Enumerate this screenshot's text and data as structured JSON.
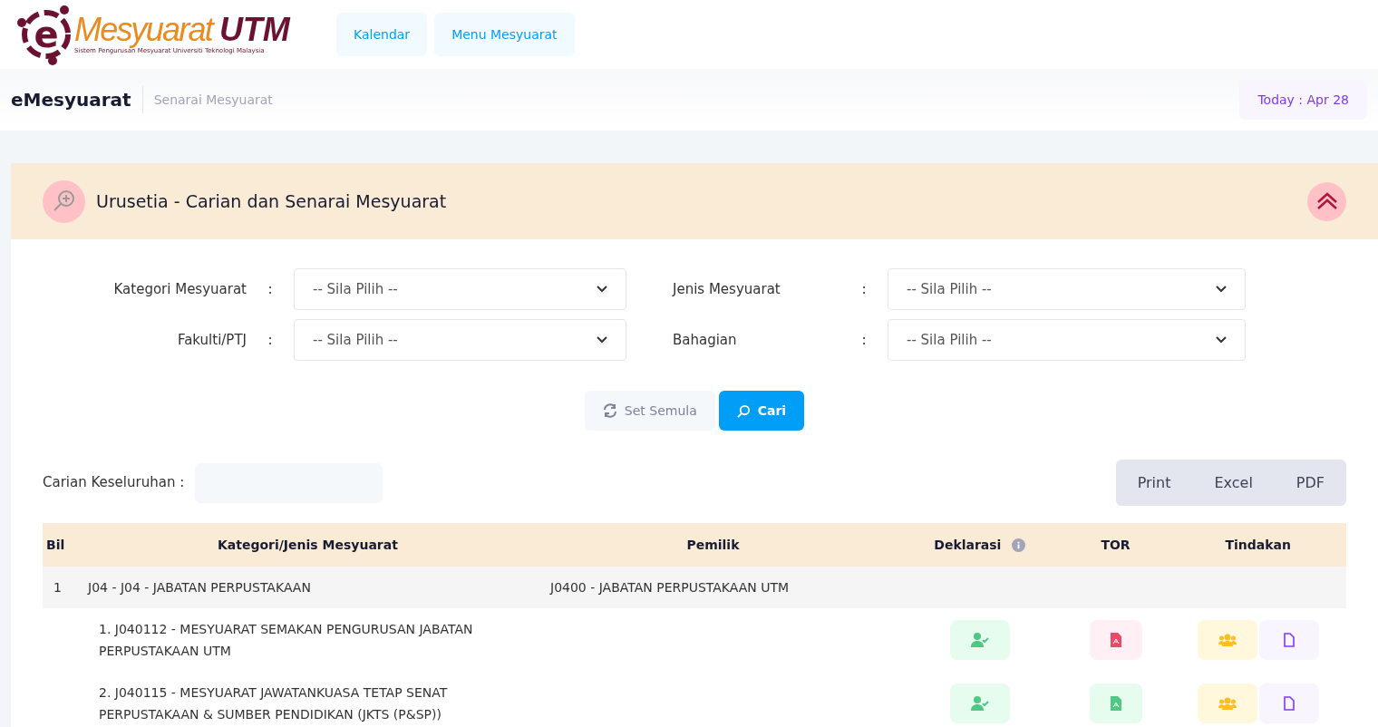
{
  "logo": {
    "mark": "e",
    "name": "Mesyuarat",
    "suffix": "UTM",
    "tagline": "Sistem Pengurusan Mesyuarat Universiti Teknologi Malaysia"
  },
  "nav": [
    "Kalendar",
    "Menu Mesyuarat"
  ],
  "breadcrumb": {
    "title": "eMesyuarat",
    "page": "Senarai Mesyuarat",
    "today": "Today : Apr 28"
  },
  "panel": {
    "title": "Urusetia - Carian dan Senarai Mesyuarat",
    "filters": [
      {
        "label": "Kategori Mesyuarat",
        "value": "-- Sila Pilih --"
      },
      {
        "label": "Jenis Mesyuarat",
        "value": "-- Sila Pilih --"
      },
      {
        "label": "Fakulti/PTJ",
        "value": "-- Sila Pilih --"
      },
      {
        "label": "Bahagian",
        "value": "-- Sila Pilih --"
      }
    ],
    "separator": ":",
    "reset_button": "Set Semula",
    "search_button": "Cari",
    "global_search": {
      "label": "Carian Keseluruhan :"
    },
    "export_buttons": [
      "Print",
      "Excel",
      "PDF"
    ],
    "table": {
      "columns": [
        "Bil",
        "Kategori/Jenis Mesyuarat",
        "Pemilik",
        "Deklarasi",
        "TOR",
        "Tindakan"
      ],
      "groups": [
        {
          "bil": "1",
          "category": "J04 - J04 - JABATAN PERPUSTAKAAN",
          "owner": "J0400 - JABATAN PERPUSTAKAAN UTM",
          "meetings": [
            {
              "name": "1. J040112 - MESYUARAT SEMAKAN PENGURUSAN JABATAN PERPUSTAKAAN UTM",
              "color": "#e94a6a"
            },
            {
              "name": "2. J040115 - MESYUARAT JAWATANKUASA TETAP SENAT PERPUSTAKAAN & SUMBER PENDIDIKAN (JKTS (P&SP))",
              "color": "#4fc785"
            }
          ]
        }
      ]
    }
  }
}
